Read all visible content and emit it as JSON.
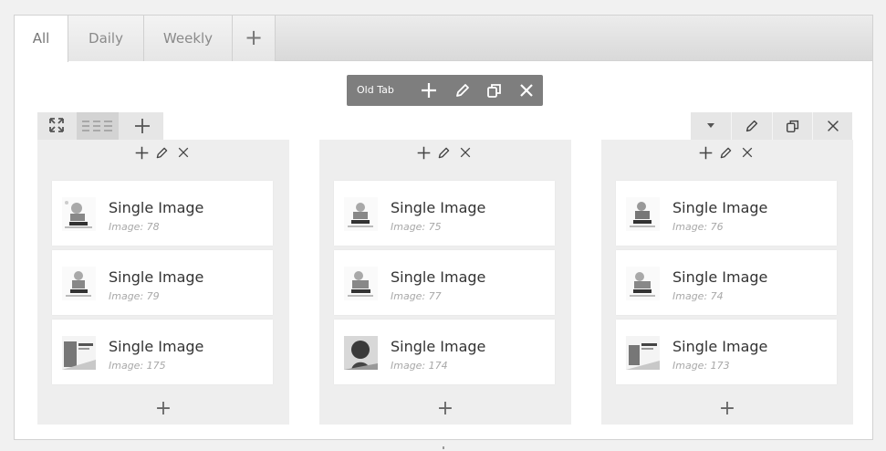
{
  "tabs": [
    {
      "label": "All",
      "active": true
    },
    {
      "label": "Daily",
      "active": false
    },
    {
      "label": "Weekly",
      "active": false
    }
  ],
  "add_tab_label": "+",
  "tab_toolbar": {
    "label": "Old Tab",
    "icons": [
      "plus-icon",
      "pencil-icon",
      "copy-icon",
      "close-icon"
    ]
  },
  "layout_toolbar": {
    "icons": [
      "expand-icon",
      "layout-icon",
      "plus-icon"
    ]
  },
  "row_toolbar": {
    "icons": [
      "dropdown-icon",
      "pencil-icon",
      "copy-icon",
      "close-icon"
    ]
  },
  "columns": [
    {
      "icons": [
        "plus-icon",
        "pencil-icon",
        "close-icon"
      ],
      "widgets": [
        {
          "title": "Single Image",
          "subtitle": "Image: 78",
          "thumb": "promo"
        },
        {
          "title": "Single Image",
          "subtitle": "Image: 79",
          "thumb": "promo"
        },
        {
          "title": "Single Image",
          "subtitle": "Image: 175",
          "thumb": "banner"
        }
      ],
      "add_label": "+"
    },
    {
      "icons": [
        "plus-icon",
        "pencil-icon",
        "close-icon"
      ],
      "widgets": [
        {
          "title": "Single Image",
          "subtitle": "Image: 75",
          "thumb": "promo"
        },
        {
          "title": "Single Image",
          "subtitle": "Image: 77",
          "thumb": "promo"
        },
        {
          "title": "Single Image",
          "subtitle": "Image: 174",
          "thumb": "portrait"
        }
      ],
      "add_label": "+"
    },
    {
      "icons": [
        "plus-icon",
        "pencil-icon",
        "close-icon"
      ],
      "widgets": [
        {
          "title": "Single Image",
          "subtitle": "Image: 76",
          "thumb": "promo"
        },
        {
          "title": "Single Image",
          "subtitle": "Image: 74",
          "thumb": "promo"
        },
        {
          "title": "Single Image",
          "subtitle": "Image: 173",
          "thumb": "banner"
        }
      ],
      "add_label": "+"
    }
  ],
  "colors": {
    "background": "#f1f1f1",
    "column": "#eeeeee",
    "card": "#ffffff",
    "tab_toolbar": "#7e7e7e",
    "text": "#333333",
    "muted_text": "#a8a8a8"
  }
}
